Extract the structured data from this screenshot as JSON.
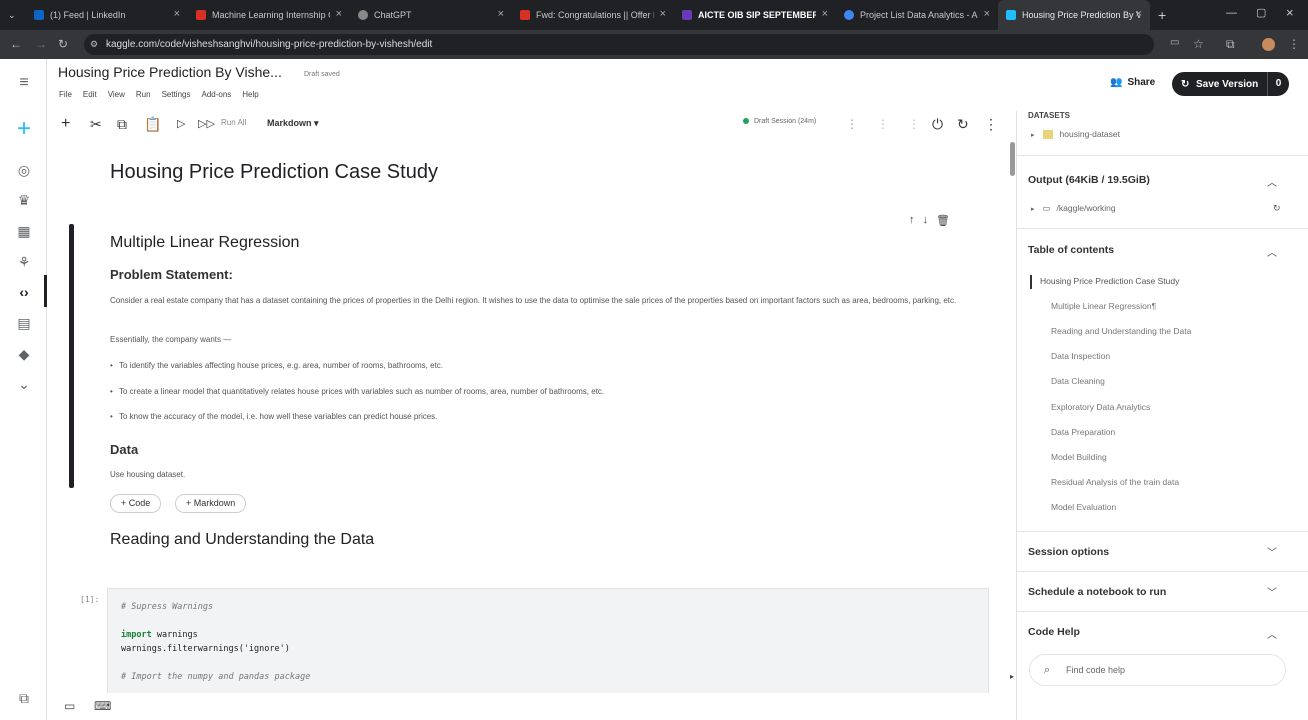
{
  "browser": {
    "tabs": [
      {
        "title": "(1) Feed | LinkedIn",
        "color": "#0a66c2"
      },
      {
        "title": "Machine Learning Internship O",
        "color": "#d93025"
      },
      {
        "title": "ChatGPT",
        "color": "#aaaaaa"
      },
      {
        "title": "Fwd: Congratulations || Offer L",
        "color": "#d93025"
      },
      {
        "title": "AICTE OIB SIP SEPTEMBER",
        "color": "#673ab7"
      },
      {
        "title": "Project List Data Analytics - Ai",
        "color": "#4285f4"
      },
      {
        "title": "Housing Price Prediction By Vis",
        "color": "#20beff"
      }
    ],
    "new_tab": "+",
    "url": "kaggle.com/code/visheshsanghvi/housing-price-prediction-by-vishesh/edit"
  },
  "notebook": {
    "title": "Housing Price Prediction By Vishe...",
    "draft_status": "Draft saved",
    "menu": [
      "File",
      "Edit",
      "View",
      "Run",
      "Settings",
      "Add-ons",
      "Help"
    ],
    "share": "Share",
    "save_version": "Save Version",
    "save_count": "0"
  },
  "toolbar": {
    "run_all": "Run All",
    "cell_type": "Markdown",
    "session": "Draft Session (24m)"
  },
  "content": {
    "h1": "Housing Price Prediction Case Study",
    "h2_mlr": "Multiple Linear Regression",
    "h3_problem": "Problem Statement:",
    "para1": "Consider a real estate company that has a dataset containing the prices of properties in the Delhi region. It wishes to use the data to optimise the sale prices of the properties based on important factors such as area, bedrooms, parking, etc.",
    "para2": "Essentially, the company wants —",
    "bullets": [
      "To identify the variables affecting house prices, e.g. area, number of rooms, bathrooms, etc.",
      "To create a linear model that quantitatively relates house prices with variables such as number of rooms, area, number of bathrooms, etc.",
      "To know the accuracy of the model, i.e. how well these variables can predict house prices."
    ],
    "h3_data": "Data",
    "use_data": "Use housing dataset.",
    "add_code": "+ Code",
    "add_markdown": "+ Markdown",
    "h2_reading": "Reading and Understanding the Data",
    "cell_number": "[1]:",
    "code": {
      "c1": "# Supress Warnings",
      "import_kw": "import",
      "import_mod": " warnings",
      "filter": "warnings.filterwarnings('ignore')",
      "c2": "# Import the numpy and pandas package"
    }
  },
  "panel": {
    "datasets_label": "DATASETS",
    "dataset_name": "housing-dataset",
    "output_header": "Output (64KiB / 19.5GiB)",
    "output_path": "/kaggle/working",
    "toc_header": "Table of contents",
    "toc": [
      "Housing Price Prediction Case Study",
      "Multiple Linear Regression¶",
      "Reading and Understanding the Data",
      "Data Inspection",
      "Data Cleaning",
      "Exploratory Data Analytics",
      "Data Preparation",
      "Model Building",
      "Residual Analysis of the train data",
      "Model Evaluation"
    ],
    "session_options": "Session options",
    "schedule": "Schedule a notebook to run",
    "code_help": "Code Help",
    "code_help_placeholder": "Find code help"
  }
}
